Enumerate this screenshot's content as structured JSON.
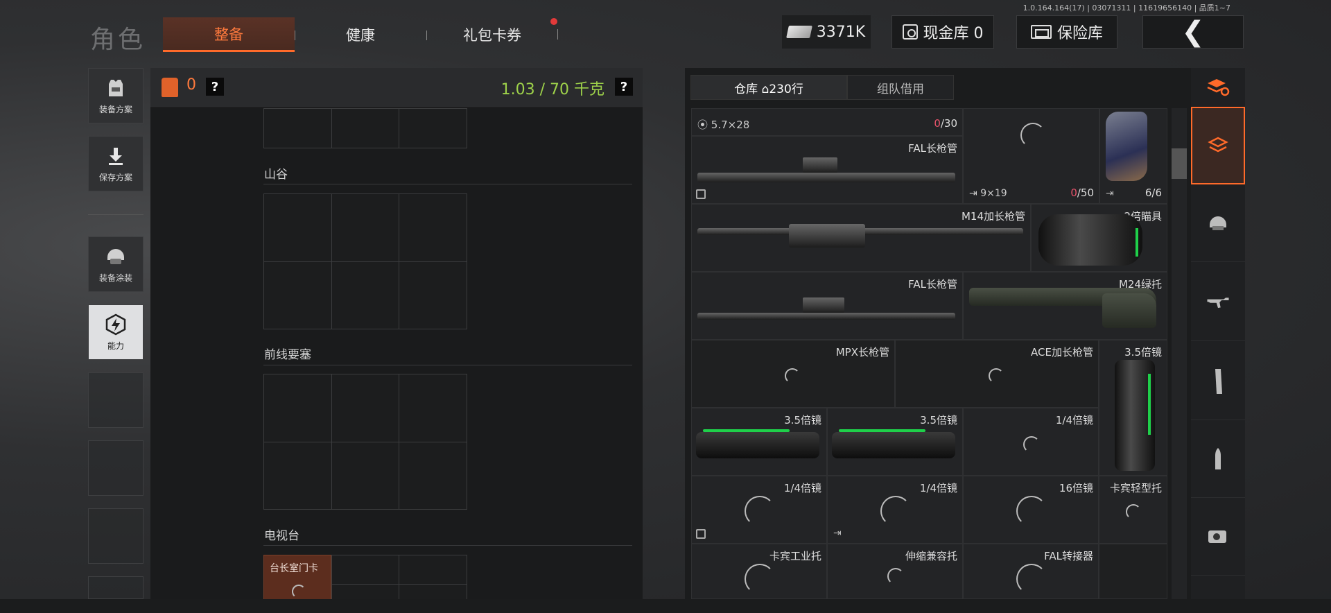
{
  "version": "1.0.164.164(17) | 03071311 | 11619656140 | 品质1~7",
  "header": {
    "title": "角色",
    "tabs": [
      {
        "label": "整备",
        "active": true
      },
      {
        "label": "健康",
        "active": false
      },
      {
        "label": "礼包卡券",
        "active": false
      }
    ],
    "currency": "3371K",
    "cash_vault": "现金库 0",
    "safe": "保险库"
  },
  "sidebar": {
    "items": [
      {
        "label": "装备方案",
        "icon": "vest-icon"
      },
      {
        "label": "保存方案",
        "icon": "download-icon"
      },
      {
        "label": "装备涂装",
        "icon": "helmet-icon"
      },
      {
        "label": "能力",
        "icon": "lightning-icon",
        "active": true
      }
    ]
  },
  "loadout": {
    "vest_count": "0",
    "weight": "1.03 / 70 千克",
    "help": "?",
    "sections": [
      {
        "label": "山谷"
      },
      {
        "label": "前线要塞"
      },
      {
        "label": "电视台"
      }
    ],
    "keycard": "台长室门卡"
  },
  "warehouse": {
    "tabs": [
      {
        "label": "仓库 ⌂230行",
        "active": true
      },
      {
        "label": "组队借用",
        "active": false
      }
    ],
    "ammo1": {
      "info": "5.7×28",
      "count_red": "0",
      "count_total": "/30"
    },
    "ammo2": {
      "info": "9×19",
      "count_red": "0",
      "count_total": "/50"
    },
    "revolver_count": "6/6",
    "items": {
      "fal_barrel_1": "FAL长枪管",
      "m14_barrel": "M14加长枪管",
      "scope_2x": "2倍瞄具",
      "fal_barrel_2": "FAL长枪管",
      "m24_stock": "M24绿托",
      "mpx_barrel": "MPX长枪管",
      "ace_barrel": "ACE加长枪管",
      "scope_35_tall": "3.5倍镜",
      "scope_35_a": "3.5倍镜",
      "scope_35_b": "3.5倍镜",
      "scope_14_a": "1/4倍镜",
      "scope_14_b": "1/4倍镜",
      "scope_14_c": "1/4倍镜",
      "scope_16": "16倍镜",
      "kabin_light": "卡宾轻型托",
      "kabin_ind": "卡宾工业托",
      "telescopic": "伸缩兼容托",
      "fal_adapter": "FAL转接器"
    }
  },
  "colors": {
    "accent": "#ff6a2a",
    "weight": "#9ed24a",
    "red": "#e8536b",
    "scope_green": "#1fd04a"
  }
}
